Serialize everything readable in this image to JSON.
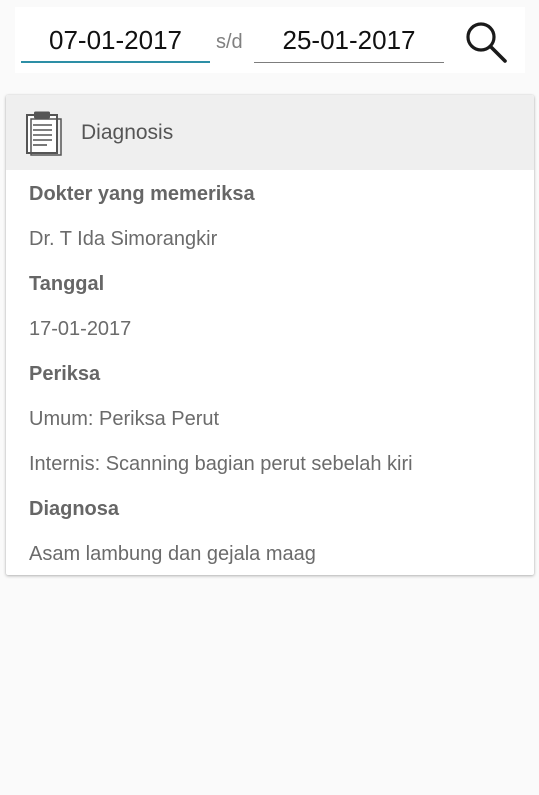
{
  "filter": {
    "date_from": "07-01-2017",
    "separator": "s/d",
    "date_to": "25-01-2017",
    "search_icon": "search-icon"
  },
  "card": {
    "icon": "clipboard-icon",
    "title": "Diagnosis",
    "doctor_label": "Dokter yang memeriksa",
    "doctor_value": "Dr. T Ida Simorangkir",
    "date_label": "Tanggal",
    "date_value": "17-01-2017",
    "exam_label": "Periksa",
    "exam_items": [
      "Umum: Periksa Perut",
      "Internis: Scanning bagian perut sebelah kiri"
    ],
    "diagnosis_label": "Diagnosa",
    "diagnosis_value": "Asam lambung dan gejala maag"
  },
  "colors": {
    "background": "#fafafa",
    "accent_underline": "#2d8fa6",
    "header_bg": "#efefef"
  }
}
